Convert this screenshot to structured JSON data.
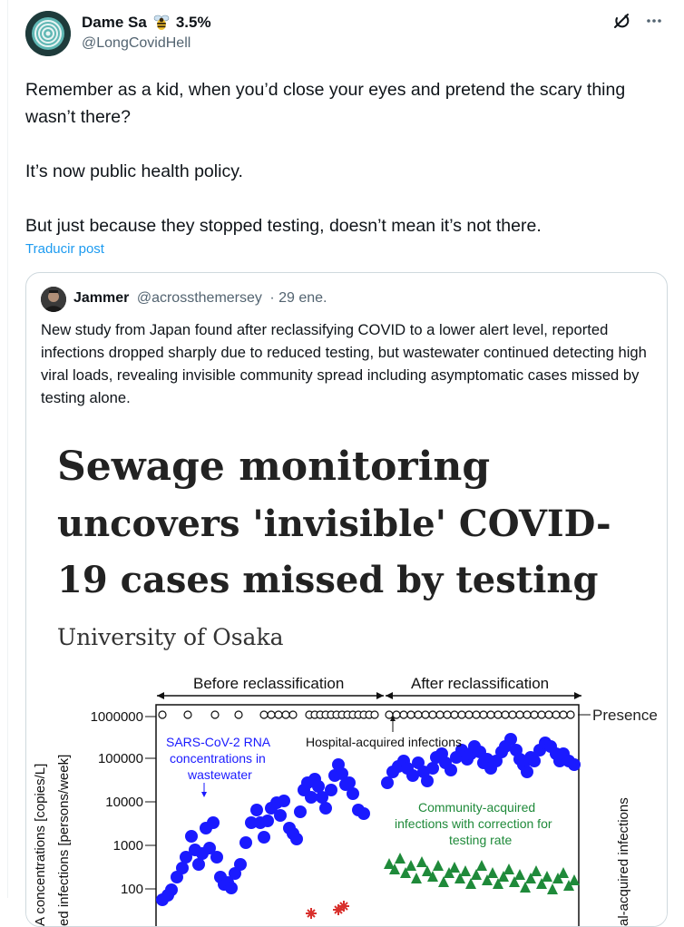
{
  "author": {
    "name": "Dame Sa",
    "badge": "3.5%",
    "handle": "@LongCovidHell"
  },
  "icons": {
    "avatar": "circular-logo-avatar",
    "badge": "bee-icon",
    "grok": "grok-icon",
    "more": "more-icon"
  },
  "tweet": {
    "paragraphs": [
      "Remember as a kid, when you’d close your eyes and pretend the scary thing wasn’t there?",
      "It’s now public health policy.",
      "But just because they stopped testing, doesn’t mean it’s not there."
    ],
    "translate": "Traducir post"
  },
  "quote": {
    "name": "Jammer",
    "handle": "@acrossthemersey",
    "date": "· 29 ene.",
    "text": "New study from Japan found after reclassifying COVID to a lower alert level, reported infections dropped sharply due to reduced testing, but wastewater continued detecting high viral loads, revealing invisible community spread including asymptomatic cases missed by testing alone."
  },
  "image": {
    "headline_lines": [
      "Sewage monitoring",
      "uncovers 'invisible' COVID-",
      "19 cases missed by testing"
    ],
    "source": "University of Osaka",
    "before_label": "Before reclassification",
    "after_label": "After reclassification",
    "presence_label": "Presence",
    "yticks": [
      "1000000",
      "100000",
      "10000",
      "1000",
      "100"
    ],
    "ylabel_1": "A concentrations [copies/L]",
    "ylabel_2": "ed infections [persons/week]",
    "ylabel_right": "al-acquired infections",
    "series_label_sars": [
      "SARS-CoV-2 RNA",
      "concentrations in",
      "wastewater"
    ],
    "series_label_hospital": "Hospital-acquired infections",
    "series_label_community": [
      "Community-acquired",
      "infections with correction for",
      "testing rate"
    ]
  },
  "colors": {
    "text": "#0f1419",
    "muted": "#536471",
    "link": "#1d9bf0",
    "border": "#cfd9de",
    "blue_series": "#1a1aff",
    "green_series": "#1f8a3a",
    "red_series": "#d9302c"
  }
}
